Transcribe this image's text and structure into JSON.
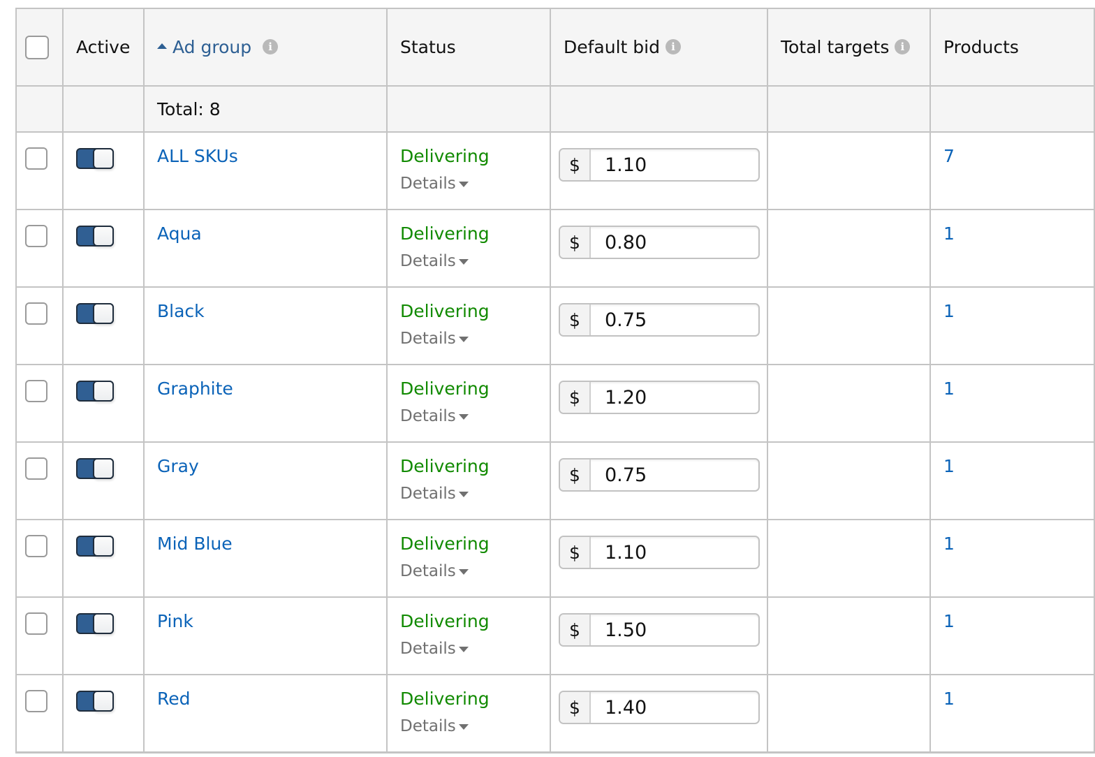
{
  "header": {
    "active": "Active",
    "ad_group": "Ad group",
    "status": "Status",
    "default_bid": "Default bid",
    "total_targets": "Total targets",
    "products": "Products",
    "info_glyph": "i"
  },
  "total": {
    "label": "Total: 8"
  },
  "currency_symbol": "$",
  "details_label": "Details",
  "colors": {
    "link": "#0b63b8",
    "status_delivering": "#118a00",
    "toggle_on": "#305f93"
  },
  "rows": [
    {
      "name": "ALL SKUs",
      "active": true,
      "status": "Delivering",
      "bid": "1.10",
      "total_targets": "",
      "products": "7"
    },
    {
      "name": "Aqua",
      "active": true,
      "status": "Delivering",
      "bid": "0.80",
      "total_targets": "",
      "products": "1"
    },
    {
      "name": "Black",
      "active": true,
      "status": "Delivering",
      "bid": "0.75",
      "total_targets": "",
      "products": "1"
    },
    {
      "name": "Graphite",
      "active": true,
      "status": "Delivering",
      "bid": "1.20",
      "total_targets": "",
      "products": "1"
    },
    {
      "name": "Gray",
      "active": true,
      "status": "Delivering",
      "bid": "0.75",
      "total_targets": "",
      "products": "1"
    },
    {
      "name": "Mid Blue",
      "active": true,
      "status": "Delivering",
      "bid": "1.10",
      "total_targets": "",
      "products": "1"
    },
    {
      "name": "Pink",
      "active": true,
      "status": "Delivering",
      "bid": "1.50",
      "total_targets": "",
      "products": "1"
    },
    {
      "name": "Red",
      "active": true,
      "status": "Delivering",
      "bid": "1.40",
      "total_targets": "",
      "products": "1"
    }
  ]
}
